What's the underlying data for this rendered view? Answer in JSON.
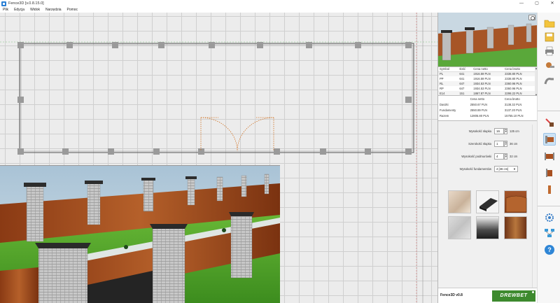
{
  "window": {
    "title": "Fence3D [v.0.8.15.0]",
    "controls": [
      "—",
      "▢",
      "✕"
    ]
  },
  "menu": [
    "Plik",
    "Edycja",
    "Widok",
    "Narzędzia",
    "Pomoc"
  ],
  "price_table": {
    "headers": [
      "Symbol",
      "Ilość",
      "Cena netto",
      "Cena brutto"
    ],
    "rows": [
      [
        "PL",
        "641",
        "1916.59 PLN",
        "2338.80 PLN"
      ],
      [
        "PP",
        "641",
        "1916.59 PLN",
        "2338.80 PLN"
      ],
      [
        "RL",
        "647",
        "1934.53 PLN",
        "2360.96 PLN"
      ],
      [
        "RP",
        "647",
        "1934.53 PLN",
        "2360.96 PLN"
      ],
      [
        "E14",
        "151",
        "1867.87 PLN",
        "2298.22 PLN"
      ]
    ]
  },
  "summary": {
    "headers": [
      "",
      "Cena netto",
      "Cena brutto"
    ],
    "rows": [
      [
        "Daszki",
        "2550.67 PLN",
        "3138.32 PLN"
      ],
      [
        "Fundamenty",
        "2550.89 PLN",
        "3137.20 PLN"
      ],
      [
        "Razem",
        "12805.80 PLN",
        "15755.10 PLN"
      ]
    ]
  },
  "params": {
    "post_height": {
      "label": "Wysokość słupka",
      "value": "16",
      "unit": "125 cm"
    },
    "post_width": {
      "label": "Szerokość słupka",
      "value": "1",
      "unit": "36 cm"
    },
    "base_height": {
      "label": "Wysokość podmurówki",
      "value": "4",
      "unit": "32 cm"
    },
    "foundation_height": {
      "label": "Wysokość fundamentów",
      "value": "4 [36 cm]"
    }
  },
  "footer": {
    "version": "Fence3D v0.8",
    "brand": "DREWBET"
  },
  "toolbar_icons": [
    "open-folder-icon",
    "save-icon",
    "print-icon",
    "settings-icon",
    "pipe-icon",
    "gate-add-icon",
    "fence-segment-icon",
    "double-gate-icon",
    "wicket-icon",
    "post-icon",
    "settings-gear-icon",
    "network-icon",
    "help-icon"
  ],
  "colors": {
    "accent": "#3d8a2e",
    "grid": "#cfcfcf",
    "plan_bg": "#ececec"
  }
}
